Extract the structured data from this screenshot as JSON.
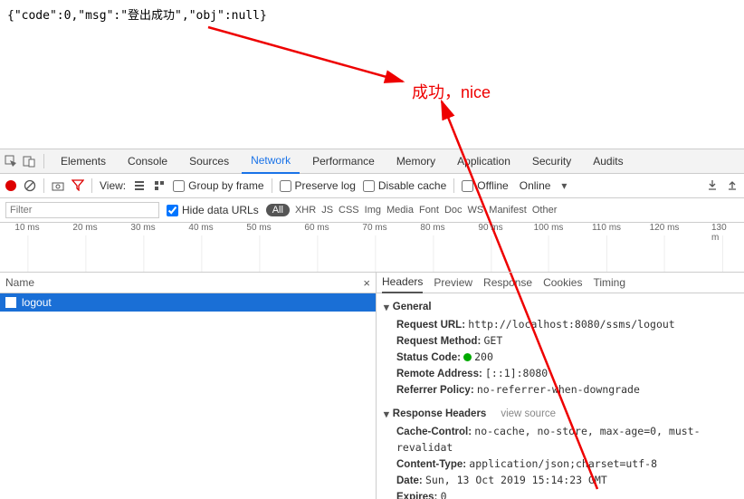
{
  "viewport_text": "{\"code\":0,\"msg\":\"登出成功\",\"obj\":null}",
  "annotation": "成功，nice",
  "tabs": [
    "Elements",
    "Console",
    "Sources",
    "Network",
    "Performance",
    "Memory",
    "Application",
    "Security",
    "Audits"
  ],
  "active_tab_index": 3,
  "toolbar": {
    "view_label": "View:",
    "group_by_frame": "Group by frame",
    "preserve_log": "Preserve log",
    "disable_cache": "Disable cache",
    "offline": "Offline",
    "online": "Online"
  },
  "filter": {
    "placeholder": "Filter",
    "hide_data_urls": "Hide data URLs",
    "types": {
      "all": "All",
      "items": [
        "XHR",
        "JS",
        "CSS",
        "Img",
        "Media",
        "Font",
        "Doc",
        "WS",
        "Manifest",
        "Other"
      ]
    }
  },
  "timeline_ticks": [
    "10 ms",
    "20 ms",
    "30 ms",
    "40 ms",
    "50 ms",
    "60 ms",
    "70 ms",
    "80 ms",
    "90 ms",
    "100 ms",
    "110 ms",
    "120 ms",
    "130 m"
  ],
  "network": {
    "name_header": "Name",
    "rows": [
      {
        "name": "logout"
      }
    ]
  },
  "detail": {
    "tabs": [
      "Headers",
      "Preview",
      "Response",
      "Cookies",
      "Timing"
    ],
    "active_index": 0,
    "general": {
      "title": "General",
      "request_url_label": "Request URL:",
      "request_url": "http://localhost:8080/ssms/logout",
      "request_method_label": "Request Method:",
      "request_method": "GET",
      "status_code_label": "Status Code:",
      "status_code": "200",
      "remote_address_label": "Remote Address:",
      "remote_address": "[::1]:8080",
      "referrer_policy_label": "Referrer Policy:",
      "referrer_policy": "no-referrer-when-downgrade"
    },
    "response_headers": {
      "title": "Response Headers",
      "view_source": "view source",
      "cache_control_label": "Cache-Control:",
      "cache_control": "no-cache, no-store, max-age=0, must-revalidat",
      "content_type_label": "Content-Type:",
      "content_type": "application/json;charset=utf-8",
      "date_label": "Date:",
      "date": "Sun, 13 Oct 2019 15:14:23 GMT",
      "expires_label": "Expires:",
      "expires": "0"
    }
  }
}
